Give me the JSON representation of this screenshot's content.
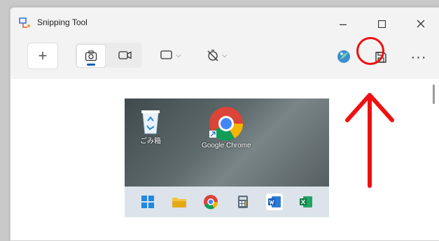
{
  "window": {
    "title": "Snipping Tool"
  },
  "titlebar": {
    "minimize_icon": "minimize-icon",
    "maximize_icon": "maximize-icon",
    "close_icon": "close-icon"
  },
  "toolbar": {
    "new_label": "+",
    "modes": [
      {
        "icon": "camera-icon",
        "active": true
      },
      {
        "icon": "video-icon",
        "active": false
      }
    ],
    "shape_icon": "rectangle-snip-icon",
    "timer_icon": "no-delay-timer-icon",
    "edit_icon": "paint-edit-icon",
    "save_icon": "save-icon",
    "more_label": "···"
  },
  "screenshot_preview": {
    "desktop_icons": [
      {
        "label": "ごみ箱",
        "icon": "recycle-bin-icon"
      },
      {
        "label": "Google Chrome",
        "icon": "chrome-icon"
      }
    ],
    "taskbar_icons": [
      "windows-start-icon",
      "file-explorer-icon",
      "chrome-icon",
      "calculator-icon",
      "word-icon",
      "excel-icon"
    ]
  },
  "annotation": {
    "color": "#ee1111"
  }
}
